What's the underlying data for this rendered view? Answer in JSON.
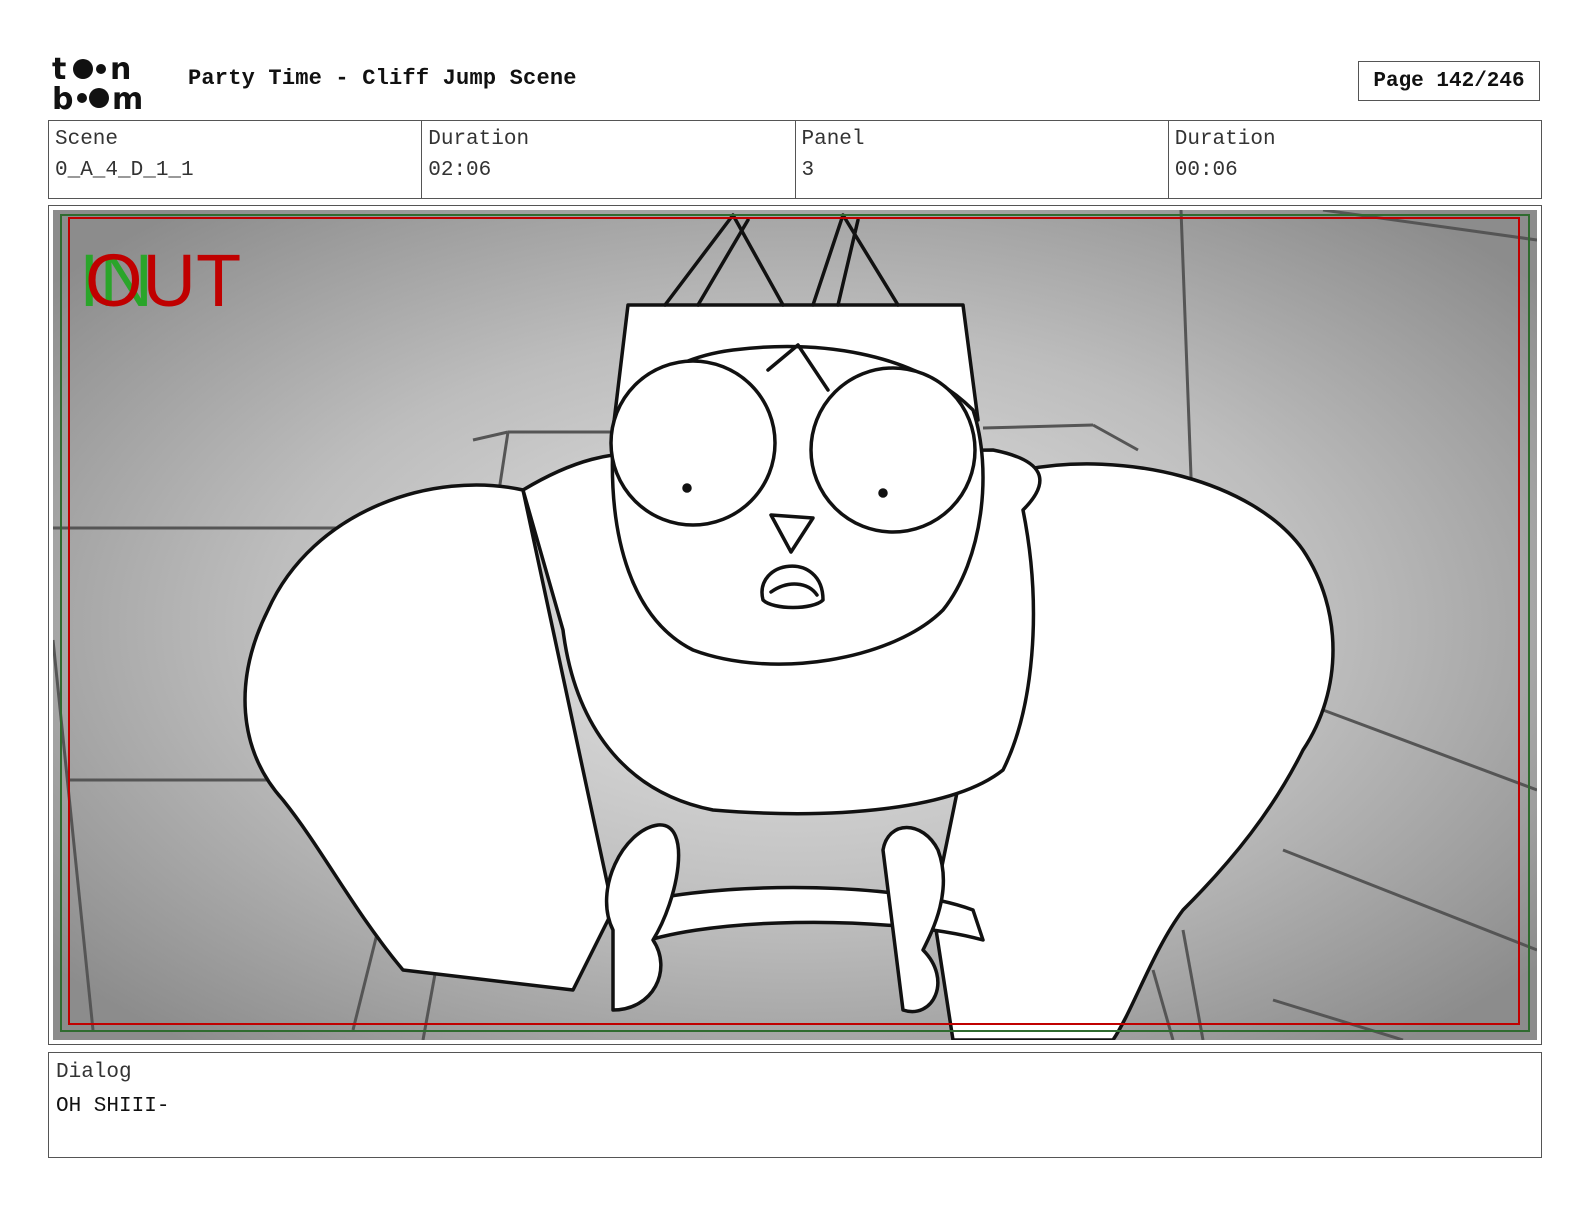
{
  "header": {
    "logo_text": "toon boom",
    "title": "Party Time - Cliff Jump Scene",
    "page_label": "Page 142/246"
  },
  "info": {
    "scene_label": "Scene",
    "scene_value": "0_A_4_D_1_1",
    "scene_duration_label": "Duration",
    "scene_duration_value": "02:06",
    "panel_label": "Panel",
    "panel_value": "3",
    "panel_duration_label": "Duration",
    "panel_duration_value": "00:06"
  },
  "panel": {
    "marker_in": "IN",
    "marker_out": "OUT",
    "colors": {
      "in_marker": "#2aa52a",
      "out_marker": "#c00000",
      "safe_frame": "#c00000",
      "field_frame": "#2f6b2f"
    }
  },
  "dialog": {
    "label": "Dialog",
    "text": "OH SHIII-"
  }
}
